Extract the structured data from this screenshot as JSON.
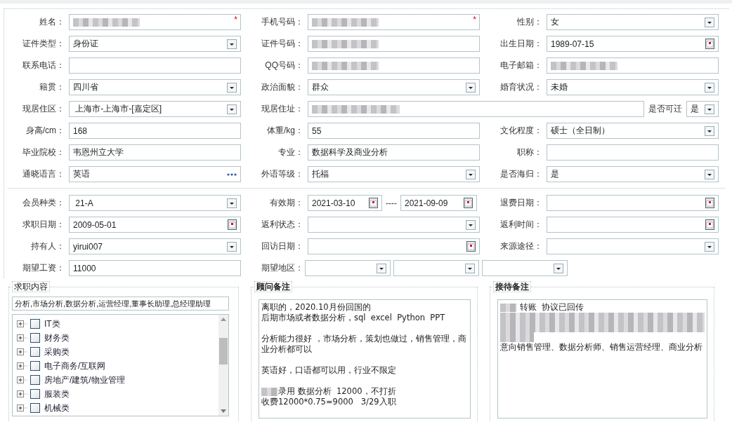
{
  "section1": {
    "rows": [
      [
        {
          "label": "姓名：",
          "kind": "text",
          "redacted": true,
          "required_mark": "*"
        },
        {
          "label": "手机号码：",
          "kind": "text",
          "redacted": true,
          "required_mark": "*"
        },
        {
          "label": "性别：",
          "kind": "select",
          "value": "女"
        }
      ],
      [
        {
          "label": "证件类型：",
          "kind": "select",
          "value": "身份证"
        },
        {
          "label": "证件号码：",
          "kind": "text",
          "redacted": true
        },
        {
          "label": "出生日期：",
          "kind": "date",
          "value": "1989-07-15"
        }
      ],
      [
        {
          "label": "联系电话：",
          "kind": "text"
        },
        {
          "label": "QQ号码：",
          "kind": "text",
          "redacted": true
        },
        {
          "label": "电子邮箱：",
          "kind": "text",
          "redacted": true
        }
      ],
      [
        {
          "label": "籍贯：",
          "kind": "select",
          "value": "四川省"
        },
        {
          "label": "政治面貌：",
          "kind": "select",
          "value": "群众"
        },
        {
          "label": "婚育状况：",
          "kind": "select",
          "value": "未婚"
        }
      ],
      [
        {
          "label": "现居住区：",
          "kind": "select",
          "value": " 上海市-上海市-[嘉定区]"
        },
        {
          "label": "现居住址：",
          "kind": "wide",
          "redacted": true,
          "extra": {
            "label": "是否可迁",
            "kind": "select",
            "value": "是"
          }
        }
      ],
      [
        {
          "label": "身高/cm：",
          "kind": "text",
          "value": "168"
        },
        {
          "label": "体重/kg：",
          "kind": "text",
          "value": "55"
        },
        {
          "label": "文化程度：",
          "kind": "select",
          "value": "硕士（全日制）"
        }
      ],
      [
        {
          "label": "毕业院校：",
          "kind": "text",
          "value": "韦恩州立大学"
        },
        {
          "label": "专业：",
          "kind": "text",
          "value": "数据科学及商业分析"
        },
        {
          "label": "职称：",
          "kind": "text"
        }
      ],
      [
        {
          "label": "通晓语言：",
          "kind": "more",
          "value": "英语"
        },
        {
          "label": "外语等级：",
          "kind": "select",
          "value": "托福"
        },
        {
          "label": "是否海归：",
          "kind": "select",
          "value": "是"
        }
      ]
    ]
  },
  "section2": {
    "rows": [
      [
        {
          "label": "会员种类：",
          "kind": "select",
          "value": " 21-A"
        },
        {
          "label": "有效期：",
          "kind": "range",
          "parts": [
            {
              "kind": "date",
              "value": "2021-03-10"
            },
            {
              "kind": "separator",
              "text": "----"
            },
            {
              "kind": "date",
              "value": "2021-09-09"
            }
          ]
        },
        {
          "label": "退费日期：",
          "kind": "date"
        }
      ],
      [
        {
          "label": "求职日期：",
          "kind": "date",
          "value": "2009-05-01"
        },
        {
          "label": "返利状态：",
          "kind": "select"
        },
        {
          "label": "返利时间：",
          "kind": "date"
        }
      ],
      [
        {
          "label": "持有人：",
          "kind": "select",
          "value": "yirui007"
        },
        {
          "label": "回访日期：",
          "kind": "date"
        },
        {
          "label": "来源途径：",
          "kind": "select"
        }
      ],
      [
        {
          "label": "期望工资：",
          "kind": "text",
          "value": "11000"
        },
        {
          "label": "期望地区：",
          "kind": "multi",
          "parts": [
            {
              "kind": "select"
            },
            {
              "kind": "select"
            },
            {
              "kind": "select"
            }
          ]
        }
      ]
    ]
  },
  "job_intent": {
    "legend": "求职内容",
    "selected_text": "分析,市场分析,数据分析,运营经理,董事长助理,总经理助理",
    "categories": [
      {
        "label": "IT类",
        "checked": false,
        "expanded": false
      },
      {
        "label": "财务类",
        "checked": false,
        "expanded": false
      },
      {
        "label": "采购类",
        "checked": false,
        "expanded": false
      },
      {
        "label": "电子商务/互联网",
        "checked": false,
        "expanded": false
      },
      {
        "label": "房地产/建筑/物业管理",
        "checked": false,
        "expanded": false
      },
      {
        "label": "服装类",
        "checked": false,
        "expanded": false
      },
      {
        "label": "机械类",
        "checked": false,
        "expanded": false
      }
    ]
  },
  "consultant_notes": {
    "legend": "顾问备注",
    "paragraphs": [
      {
        "lines": [
          {
            "text": "离职的，2020.10月份回国的"
          },
          {
            "text": "后期市场或者数据分析，sql  excel  Python  PPT"
          }
        ]
      },
      {
        "lines": [
          {
            "text": "分析能力很好 ，市场分析，策划也做过，销售管理，商"
          },
          {
            "text": "业分析都可以"
          }
        ]
      },
      {
        "lines": [
          {
            "text": "英语好，口语都可以用，行业不限定"
          }
        ]
      },
      {
        "lines": [
          {
            "text": "录用 数据分析  12000，不打折",
            "redacted_prefix": true
          },
          {
            "text": "收费12000*0.75=9000   3/29入职"
          }
        ]
      }
    ]
  },
  "reception_notes": {
    "legend": "接待备注",
    "paragraphs": [
      {
        "lines": [
          {
            "text": " 转账  协议已回传",
            "redacted_prefix": true
          },
          {
            "redacted": true
          },
          {
            "redacted": true
          },
          {
            "redacted": true,
            "short": true
          },
          {
            "text": "意向销售管理、数据分析师、销售运营经理、商业分析"
          }
        ]
      }
    ]
  }
}
